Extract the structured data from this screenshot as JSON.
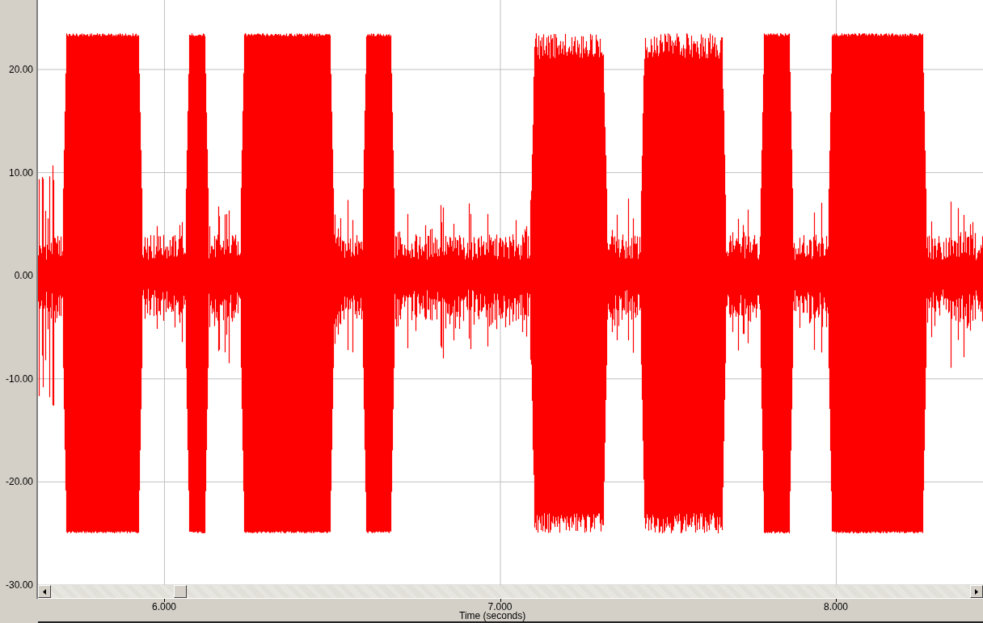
{
  "plot": {
    "y_tick_labels": [
      "20.00",
      "10.00",
      "0.00",
      "-10.00",
      "-20.00",
      "-30.00"
    ],
    "x_tick_labels": [
      "6.000",
      "7.000",
      "8.000"
    ],
    "x_axis_title": "Time (seconds)"
  }
}
